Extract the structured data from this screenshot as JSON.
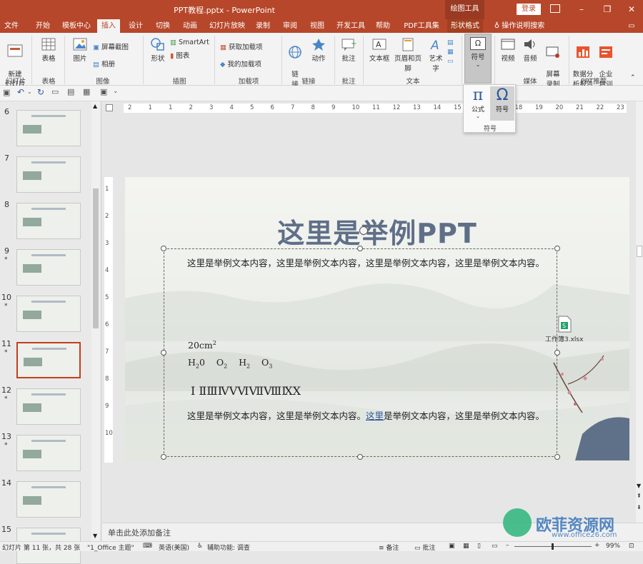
{
  "window": {
    "title": "PPT教程.pptx - PowerPoint",
    "context_tab_group": "绘图工具",
    "login_label": "登录",
    "minimize": "–",
    "restore": "❐",
    "close": "✕"
  },
  "tabs": [
    "文件",
    "开始",
    "模板中心",
    "插入",
    "设计",
    "切换",
    "动画",
    "幻灯片放映",
    "录制",
    "审阅",
    "视图",
    "开发工具",
    "帮助",
    "PDF工具集",
    "形状格式"
  ],
  "active_tab": "插入",
  "tell_me": "操作说明搜索",
  "ribbon": {
    "new_slide": "新建\n幻灯片",
    "table": "表格",
    "picture": "图片",
    "screenshot": "屏幕截图",
    "album": "相册",
    "shapes": "形状",
    "smartart": "SmartArt",
    "chart": "图表",
    "get_addins": "获取加载项",
    "my_addins": "我的加载项",
    "link": "链\n接",
    "action": "动作",
    "comment": "批注",
    "textbox": "文本框",
    "header_footer": "页眉和页脚",
    "wordart": "艺术字",
    "symbols": "符号",
    "video": "视频",
    "audio": "音频",
    "screen_record": "屏幕\n录制",
    "data_report": "数据分\n析报告",
    "enterprise_training": "企业\n培训",
    "groups": {
      "slides": "幻灯片",
      "tables": "表格",
      "images": "图像",
      "illustrations": "插图",
      "addins": "加载项",
      "links": "链接",
      "comments": "批注",
      "text": "文本",
      "media": "媒体",
      "ppt_recommend": "PPT推荐"
    }
  },
  "symbols_dropdown": {
    "equation": "公式",
    "symbol": "符号",
    "group": "符号",
    "pi": "π",
    "omega": "Ω"
  },
  "slides": [
    {
      "num": "6",
      "star": ""
    },
    {
      "num": "7",
      "star": ""
    },
    {
      "num": "8",
      "star": ""
    },
    {
      "num": "9",
      "star": "*"
    },
    {
      "num": "10",
      "star": "*"
    },
    {
      "num": "11",
      "star": "*"
    },
    {
      "num": "12",
      "star": "*"
    },
    {
      "num": "13",
      "star": "*"
    },
    {
      "num": "14",
      "star": ""
    },
    {
      "num": "15",
      "star": ""
    }
  ],
  "active_slide": "11",
  "ruler_h": [
    "2",
    "1",
    "1",
    "2",
    "3",
    "4",
    "5",
    "6",
    "7",
    "8",
    "9",
    "10",
    "11",
    "12",
    "13",
    "14",
    "15",
    "16",
    "17",
    "18",
    "19",
    "20",
    "21",
    "22",
    "23"
  ],
  "ruler_v": [
    "1",
    "2",
    "3",
    "4",
    "5",
    "6",
    "7",
    "8",
    "9",
    "10"
  ],
  "slide": {
    "title": "这里是举例PPT",
    "para1": "这里是举例文本内容，这里是举例文本内容，这里是举例文本内容，这里是举例文本内容。",
    "area_base": "20cm",
    "area_sup": "2",
    "chem": [
      {
        "base": "H",
        "sub": "2",
        "tail": "0"
      },
      {
        "base": "O",
        "sub": "2",
        "tail": ""
      },
      {
        "base": "H",
        "sub": "2",
        "tail": ""
      },
      {
        "base": "O",
        "sub": "3",
        "tail": ""
      }
    ],
    "roman": "Ⅰ ⅡⅢⅣⅤⅥⅦⅧⅨⅩ",
    "para2_before": "这里是举例文本内容，这里是举例文本内容。",
    "para2_link": "这里",
    "para2_after": "是举例文本内容，这里是举例文本内容。",
    "embedded_file": "工作簿3.xlsx"
  },
  "notes_placeholder": "单击此处添加备注",
  "status": {
    "slide_info": "幻灯片 第 11 张，共 28 张",
    "theme": "\"1_Office 主题\"",
    "language": "英语(美国)",
    "accessibility": "辅助功能: 调查",
    "notes": "备注",
    "comments": "批注",
    "zoom": "99%"
  },
  "watermark": {
    "brand": "欧菲资源网",
    "url": "www.office26.com"
  },
  "colors": {
    "accent": "#b7472a",
    "link": "#2f5597"
  }
}
